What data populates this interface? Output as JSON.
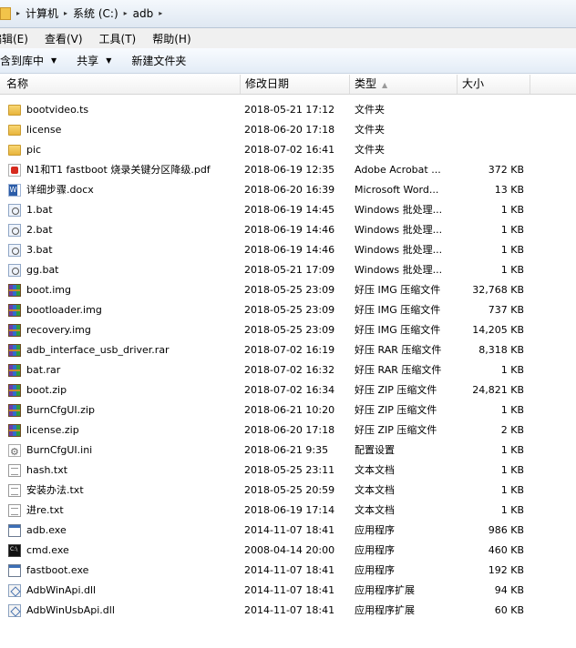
{
  "address_bar": {
    "crumbs": [
      "计算机",
      "系统 (C:)",
      "adb"
    ]
  },
  "menu": [
    "编辑(E)",
    "查看(V)",
    "工具(T)",
    "帮助(H)"
  ],
  "toolbar": {
    "include_library": "包含到库中",
    "share": "共享",
    "new_folder": "新建文件夹"
  },
  "columns": {
    "name": "名称",
    "date": "修改日期",
    "type": "类型",
    "size": "大小"
  },
  "files": [
    {
      "name": "bootvideo.ts",
      "date": "2018-05-21 17:12",
      "type": "文件夹",
      "size": "",
      "icon": "folder-icon",
      "kind": "folder"
    },
    {
      "name": "license",
      "date": "2018-06-20 17:18",
      "type": "文件夹",
      "size": "",
      "icon": "folder-icon",
      "kind": "folder"
    },
    {
      "name": "pic",
      "date": "2018-07-02 16:41",
      "type": "文件夹",
      "size": "",
      "icon": "folder-icon",
      "kind": "folder"
    },
    {
      "name": "N1和T1 fastboot 烧录关键分区降级.pdf",
      "date": "2018-06-19 12:35",
      "type": "Adobe Acrobat ...",
      "size": "372 KB",
      "icon": "pdf-icon",
      "kind": "pdf"
    },
    {
      "name": "详细步骤.docx",
      "date": "2018-06-20 16:39",
      "type": "Microsoft Word...",
      "size": "13 KB",
      "icon": "word-doc-icon",
      "kind": "doc"
    },
    {
      "name": "1.bat",
      "date": "2018-06-19 14:45",
      "type": "Windows 批处理...",
      "size": "1 KB",
      "icon": "batch-file-icon",
      "kind": "bat"
    },
    {
      "name": "2.bat",
      "date": "2018-06-19 14:46",
      "type": "Windows 批处理...",
      "size": "1 KB",
      "icon": "batch-file-icon",
      "kind": "bat"
    },
    {
      "name": "3.bat",
      "date": "2018-06-19 14:46",
      "type": "Windows 批处理...",
      "size": "1 KB",
      "icon": "batch-file-icon",
      "kind": "bat"
    },
    {
      "name": "gg.bat",
      "date": "2018-05-21 17:09",
      "type": "Windows 批处理...",
      "size": "1 KB",
      "icon": "batch-file-icon",
      "kind": "bat"
    },
    {
      "name": "boot.img",
      "date": "2018-05-25 23:09",
      "type": "好压 IMG 压缩文件",
      "size": "32,768 KB",
      "icon": "archive-icon",
      "kind": "rar"
    },
    {
      "name": "bootloader.img",
      "date": "2018-05-25 23:09",
      "type": "好压 IMG 压缩文件",
      "size": "737 KB",
      "icon": "archive-icon",
      "kind": "rar"
    },
    {
      "name": "recovery.img",
      "date": "2018-05-25 23:09",
      "type": "好压 IMG 压缩文件",
      "size": "14,205 KB",
      "icon": "archive-icon",
      "kind": "rar"
    },
    {
      "name": "adb_interface_usb_driver.rar",
      "date": "2018-07-02 16:19",
      "type": "好压 RAR 压缩文件",
      "size": "8,318 KB",
      "icon": "archive-icon",
      "kind": "rar"
    },
    {
      "name": "bat.rar",
      "date": "2018-07-02 16:32",
      "type": "好压 RAR 压缩文件",
      "size": "1 KB",
      "icon": "archive-icon",
      "kind": "rar"
    },
    {
      "name": "boot.zip",
      "date": "2018-07-02 16:34",
      "type": "好压 ZIP 压缩文件",
      "size": "24,821 KB",
      "icon": "archive-icon",
      "kind": "rar"
    },
    {
      "name": "BurnCfgUI.zip",
      "date": "2018-06-21 10:20",
      "type": "好压 ZIP 压缩文件",
      "size": "1 KB",
      "icon": "archive-icon",
      "kind": "rar"
    },
    {
      "name": "license.zip",
      "date": "2018-06-20 17:18",
      "type": "好压 ZIP 压缩文件",
      "size": "2 KB",
      "icon": "archive-icon",
      "kind": "rar"
    },
    {
      "name": "BurnCfgUI.ini",
      "date": "2018-06-21 9:35",
      "type": "配置设置",
      "size": "1 KB",
      "icon": "settings-file-icon",
      "kind": "ini"
    },
    {
      "name": "hash.txt",
      "date": "2018-05-25 23:11",
      "type": "文本文档",
      "size": "1 KB",
      "icon": "text-file-icon",
      "kind": "txt"
    },
    {
      "name": "安装办法.txt",
      "date": "2018-05-25 20:59",
      "type": "文本文档",
      "size": "1 KB",
      "icon": "text-file-icon",
      "kind": "txt"
    },
    {
      "name": "进re.txt",
      "date": "2018-06-19 17:14",
      "type": "文本文档",
      "size": "1 KB",
      "icon": "text-file-icon",
      "kind": "txt"
    },
    {
      "name": "adb.exe",
      "date": "2014-11-07 18:41",
      "type": "应用程序",
      "size": "986 KB",
      "icon": "application-icon",
      "kind": "exe"
    },
    {
      "name": "cmd.exe",
      "date": "2008-04-14 20:00",
      "type": "应用程序",
      "size": "460 KB",
      "icon": "command-prompt-icon",
      "kind": "cmd"
    },
    {
      "name": "fastboot.exe",
      "date": "2014-11-07 18:41",
      "type": "应用程序",
      "size": "192 KB",
      "icon": "application-icon",
      "kind": "exe"
    },
    {
      "name": "AdbWinApi.dll",
      "date": "2014-11-07 18:41",
      "type": "应用程序扩展",
      "size": "94 KB",
      "icon": "dll-icon",
      "kind": "dll"
    },
    {
      "name": "AdbWinUsbApi.dll",
      "date": "2014-11-07 18:41",
      "type": "应用程序扩展",
      "size": "60 KB",
      "icon": "dll-icon",
      "kind": "dll"
    }
  ]
}
